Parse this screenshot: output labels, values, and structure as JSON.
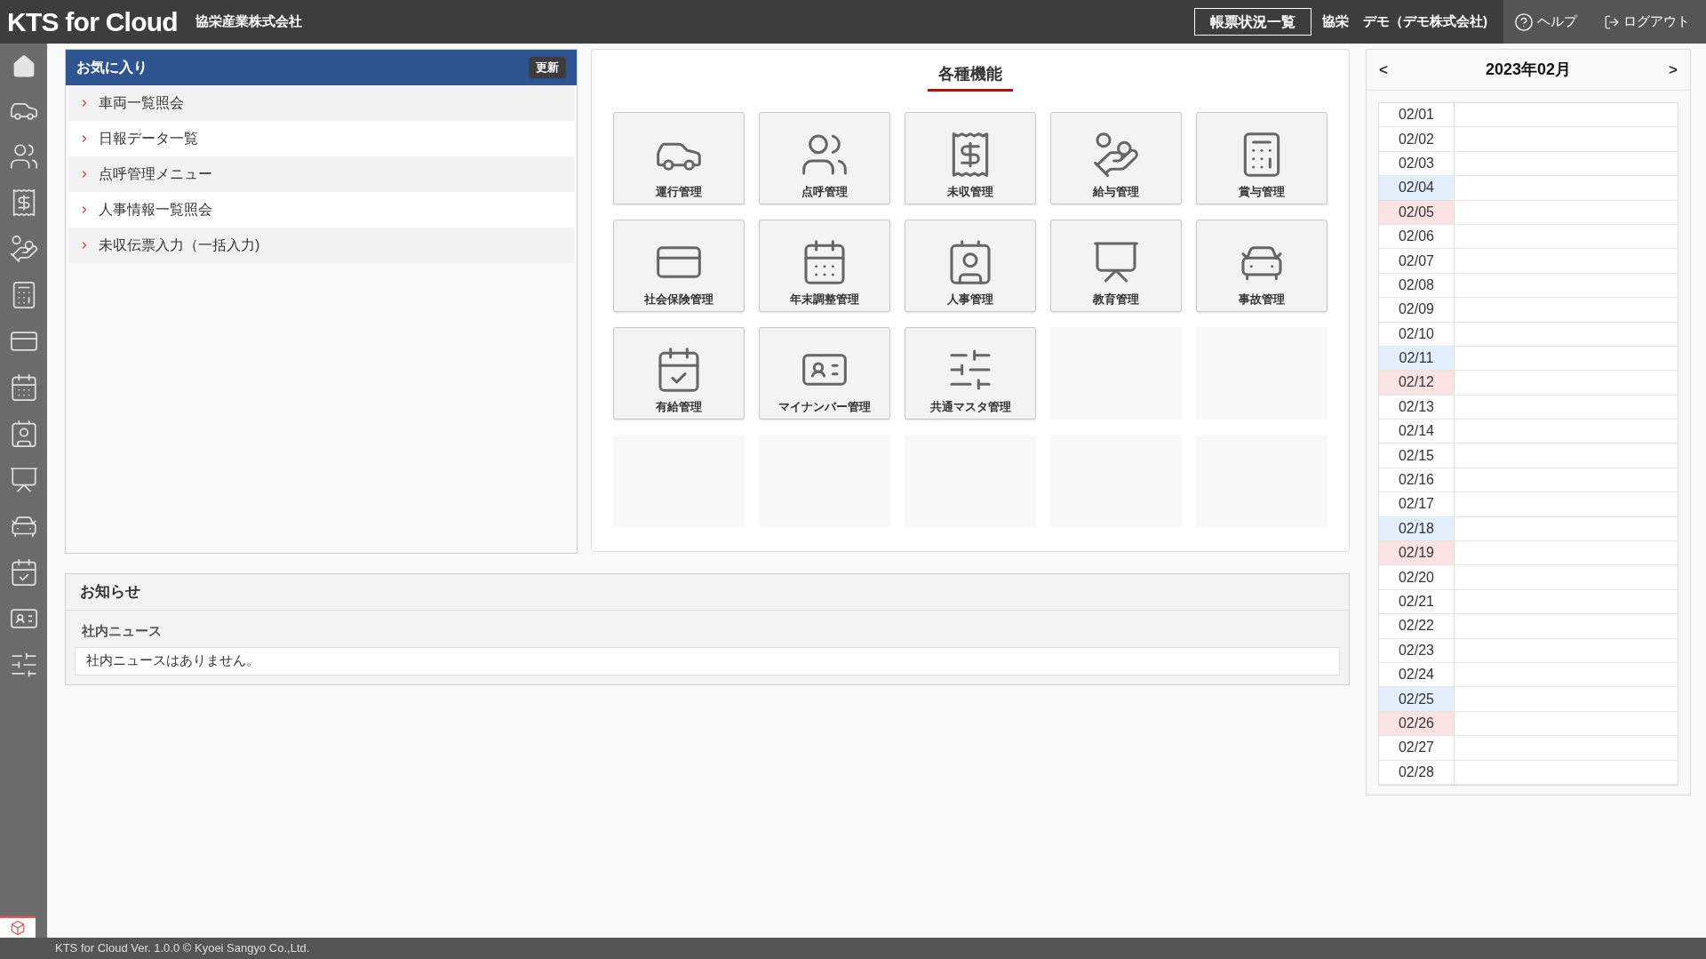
{
  "header": {
    "logo": "KTS for Cloud",
    "company": "協栄産業株式会社",
    "report_button": "帳票状況一覧",
    "user_name": "協栄",
    "user_org": "デモ（デモ株式会社)",
    "help": "ヘルプ",
    "logout": "ログアウト"
  },
  "favorites": {
    "title": "お気に入り",
    "refresh_button": "更新",
    "items": [
      {
        "label": "車両一覧照会"
      },
      {
        "label": "日報データ一覧"
      },
      {
        "label": "点呼管理メニュー"
      },
      {
        "label": "人事情報一覧照会"
      },
      {
        "label": "未収伝票入力（一括入力)"
      }
    ]
  },
  "functions": {
    "title": "各種機能",
    "tiles": [
      {
        "kind": "function",
        "label": "運行管理"
      },
      {
        "kind": "function",
        "label": "点呼管理"
      },
      {
        "kind": "function",
        "label": "未収管理"
      },
      {
        "kind": "function",
        "label": "給与管理"
      },
      {
        "kind": "function",
        "label": "賞与管理"
      },
      {
        "kind": "function",
        "label": "社会保険管理"
      },
      {
        "kind": "function",
        "label": "年末調整管理"
      },
      {
        "kind": "function",
        "label": "人事管理"
      },
      {
        "kind": "function",
        "label": "教育管理"
      },
      {
        "kind": "function",
        "label": "事故管理"
      },
      {
        "kind": "function",
        "label": "有給管理"
      },
      {
        "kind": "function",
        "label": "マイナンバー管理"
      },
      {
        "kind": "function",
        "label": "共通マスタ管理"
      },
      {
        "kind": "empty"
      },
      {
        "kind": "empty"
      },
      {
        "kind": "empty"
      },
      {
        "kind": "empty"
      },
      {
        "kind": "empty"
      },
      {
        "kind": "empty"
      },
      {
        "kind": "empty"
      }
    ]
  },
  "notices": {
    "title": "お知らせ",
    "section_title": "社内ニュース",
    "message": "社内ニュースはありません。"
  },
  "calendar": {
    "prev": "<",
    "month": "2023年02月",
    "next": ">",
    "days": [
      {
        "date": "02/01",
        "kind": "weekday"
      },
      {
        "date": "02/02",
        "kind": "weekday"
      },
      {
        "date": "02/03",
        "kind": "weekday"
      },
      {
        "date": "02/04",
        "kind": "saturday"
      },
      {
        "date": "02/05",
        "kind": "sunday"
      },
      {
        "date": "02/06",
        "kind": "weekday"
      },
      {
        "date": "02/07",
        "kind": "weekday"
      },
      {
        "date": "02/08",
        "kind": "weekday"
      },
      {
        "date": "02/09",
        "kind": "weekday"
      },
      {
        "date": "02/10",
        "kind": "weekday"
      },
      {
        "date": "02/11",
        "kind": "saturday"
      },
      {
        "date": "02/12",
        "kind": "sunday"
      },
      {
        "date": "02/13",
        "kind": "weekday"
      },
      {
        "date": "02/14",
        "kind": "weekday"
      },
      {
        "date": "02/15",
        "kind": "weekday"
      },
      {
        "date": "02/16",
        "kind": "weekday"
      },
      {
        "date": "02/17",
        "kind": "weekday"
      },
      {
        "date": "02/18",
        "kind": "saturday"
      },
      {
        "date": "02/19",
        "kind": "sunday"
      },
      {
        "date": "02/20",
        "kind": "weekday"
      },
      {
        "date": "02/21",
        "kind": "weekday"
      },
      {
        "date": "02/22",
        "kind": "weekday"
      },
      {
        "date": "02/23",
        "kind": "weekday"
      },
      {
        "date": "02/24",
        "kind": "weekday"
      },
      {
        "date": "02/25",
        "kind": "saturday"
      },
      {
        "date": "02/26",
        "kind": "sunday"
      },
      {
        "date": "02/27",
        "kind": "weekday"
      },
      {
        "date": "02/28",
        "kind": "weekday"
      }
    ]
  },
  "footer": {
    "copyright": "KTS for Cloud Ver. 1.0.0 © Kyoei Sangyo Co.,Ltd."
  }
}
